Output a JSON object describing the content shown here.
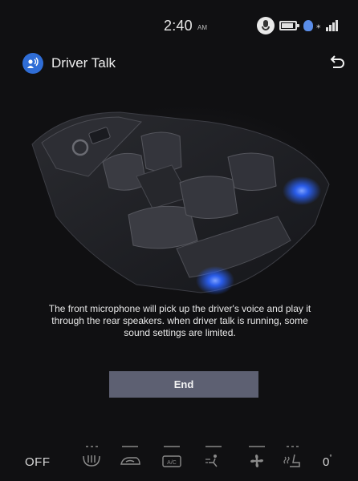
{
  "status_bar": {
    "time": "2:40",
    "ampm": "AM",
    "icons": [
      "microphone-badge-icon",
      "battery-icon",
      "voice-recognition-icon",
      "signal-strength-icon"
    ]
  },
  "header": {
    "title": "Driver Talk",
    "app_icon": "driver-talk-icon",
    "back_icon": "back-arrow-icon"
  },
  "illustration": {
    "description_icon": "car-interior-speakers-illustration",
    "accent_color": "#2b63ff"
  },
  "message": "The front microphone will pick up the driver's voice and play it through the rear speakers. when driver talk is running, some sound settings are limited.",
  "end_button": {
    "label": "End"
  },
  "climate_bar": {
    "off_label": "OFF",
    "temperature": "0",
    "temperature_unit": "°",
    "controls": [
      {
        "name": "rear-defrost-icon",
        "indicator": "dots"
      },
      {
        "name": "air-recirculation-icon",
        "indicator": "line"
      },
      {
        "name": "ac-icon",
        "label": "A/C",
        "indicator": "line"
      },
      {
        "name": "air-direction-icon",
        "indicator": "line"
      },
      {
        "name": "fan-icon",
        "indicator": "line"
      },
      {
        "name": "seat-heater-icon",
        "indicator": "dots"
      }
    ]
  }
}
